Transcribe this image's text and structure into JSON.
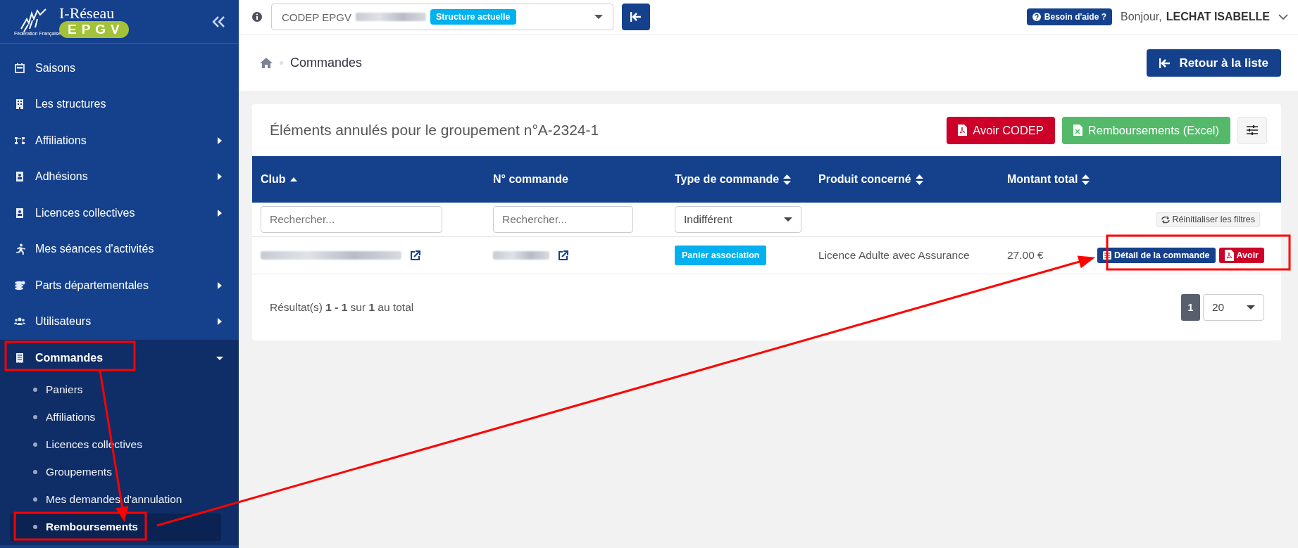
{
  "sidebar": {
    "logo": {
      "title": "I-Réseau",
      "badge": "EPGV",
      "subtitle": "Fédération Française"
    },
    "items": [
      {
        "label": "Saisons",
        "kind": "link",
        "selected": false
      },
      {
        "label": "Les structures",
        "kind": "link",
        "selected": false
      },
      {
        "label": "Affiliations",
        "kind": "group",
        "expanded": false,
        "selected": false
      },
      {
        "label": "Adhésions",
        "kind": "group",
        "expanded": false,
        "selected": false
      },
      {
        "label": "Licences collectives",
        "kind": "group",
        "expanded": false,
        "selected": false
      },
      {
        "label": "Mes séances d'activités",
        "kind": "link",
        "selected": false
      },
      {
        "label": "Parts départementales",
        "kind": "group",
        "expanded": false,
        "selected": false
      },
      {
        "label": "Utilisateurs",
        "kind": "group",
        "expanded": false,
        "selected": false
      },
      {
        "label": "Commandes",
        "kind": "group",
        "expanded": true,
        "selected": true,
        "children": [
          {
            "label": "Paniers",
            "selected": false
          },
          {
            "label": "Affiliations",
            "selected": false
          },
          {
            "label": "Licences collectives",
            "selected": false
          },
          {
            "label": "Groupements",
            "selected": false
          },
          {
            "label": "Mes demandes d'annulation",
            "selected": false
          },
          {
            "label": "Remboursements",
            "selected": true
          }
        ]
      }
    ]
  },
  "topbar": {
    "structure": {
      "value": "CODEP EPGV",
      "badge": "Structure actuelle"
    },
    "help_button": "Besoin d'aide ?",
    "greeting": "Bonjour,",
    "user": "LECHAT ISABELLE"
  },
  "breadcrumb": {
    "current": "Commandes"
  },
  "back_button": "Retour à la liste",
  "card": {
    "title": "Éléments annulés pour le groupement n°A-2324-1",
    "buttons": [
      {
        "label": "Avoir CODEP",
        "kind": "pdf"
      },
      {
        "label": "Remboursements (Excel)",
        "kind": "excel"
      }
    ],
    "table": {
      "columns": [
        {
          "label": "Club",
          "sortable": true,
          "sorted": true
        },
        {
          "label": "N° commande",
          "sortable": false
        },
        {
          "label": "Type de commande",
          "sortable": true,
          "sorted": false
        },
        {
          "label": "Produit concerné",
          "sortable": true,
          "sorted": false
        },
        {
          "label": "Montant total",
          "sortable": true,
          "sorted": false
        }
      ],
      "filters": [
        {
          "kind": "search",
          "placeholder": "Rechercher..."
        },
        {
          "kind": "search",
          "placeholder": "Rechercher..."
        },
        {
          "kind": "select",
          "value": "Indifférent"
        }
      ],
      "reset_button": "Réinitialiser les filtres",
      "rows": [
        {
          "type": "Panier association",
          "product": "Licence Adulte avec Assurance",
          "amount": "27.00 €",
          "actions": [
            {
              "label": "Détail de la commande",
              "kind": "detail"
            },
            {
              "label": "Avoir",
              "kind": "pdf"
            }
          ]
        }
      ]
    },
    "footer": {
      "summary": "Résultat(s) **1 - 1** sur **1** au total",
      "pages": [
        {
          "label": "1",
          "selected": true
        }
      ],
      "per_page": "20"
    }
  }
}
